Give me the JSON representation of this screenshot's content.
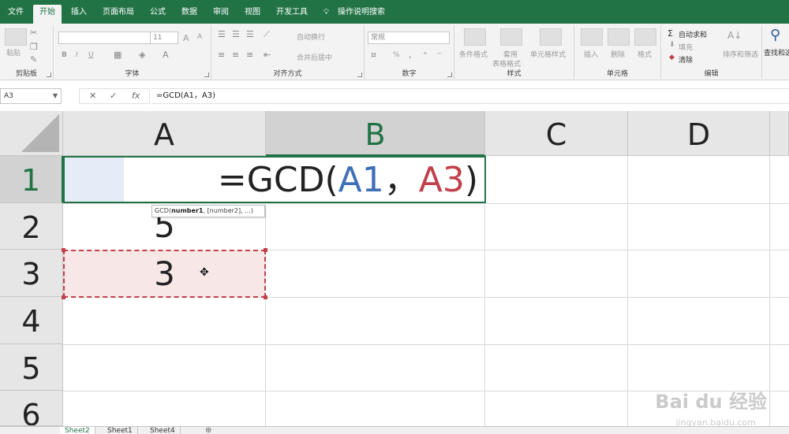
{
  "tabs": {
    "file": "文件",
    "home": "开始",
    "insert": "插入",
    "layout": "页面布局",
    "formulas": "公式",
    "data": "数据",
    "review": "审阅",
    "view": "视图",
    "developer": "开发工具",
    "help": "操作说明搜索"
  },
  "ribbon": {
    "clipboard": {
      "paste": "粘贴",
      "label": "剪贴板"
    },
    "font": {
      "size": "11",
      "bold": "B",
      "italic": "I",
      "underline": "U",
      "grow": "A",
      "shrink": "A",
      "label": "字体"
    },
    "alignment": {
      "wrap": "自动换行",
      "merge": "合并后居中",
      "label": "对齐方式"
    },
    "number": {
      "format": "常规",
      "percent": "%",
      "label": "数字"
    },
    "styles": {
      "conditional": "条件格式",
      "table1": "套用",
      "table2": "表格格式",
      "cell_styles": "单元格样式",
      "label": "样式"
    },
    "cells": {
      "insert": "插入",
      "delete": "删除",
      "format": "格式",
      "label": "单元格"
    },
    "editing": {
      "autosum": "自动求和",
      "fill": "填充",
      "clear": "清除",
      "sort": "排序和筛选",
      "find": "查找和选",
      "label": "编辑"
    }
  },
  "formula_bar": {
    "name_box": "A3",
    "cancel": "✕",
    "enter": "✓",
    "fx": "fx",
    "formula": "=GCD(A1，A3)"
  },
  "columns": [
    "A",
    "B",
    "C",
    "D"
  ],
  "rows": [
    "1",
    "2",
    "3",
    "4",
    "5",
    "6"
  ],
  "cells": {
    "B1_prefix": "=GCD(",
    "B1_ref1": "A1",
    "B1_sep": "，",
    "B1_ref2": "A3",
    "B1_suffix": ")",
    "A2": "5",
    "A3": "3"
  },
  "tooltip": {
    "fn": "GCD(",
    "arg1": "number1",
    "rest": ", [number2], ...)"
  },
  "sheets": [
    "Sheet2",
    "Sheet1",
    "Sheet4"
  ],
  "active_sheet": "Sheet2",
  "watermark": {
    "main": "Bai du 经验",
    "sub": "jingyan.baidu.com"
  },
  "colors": {
    "excel_green": "#217346",
    "ref_blue": "#3f6fb6",
    "ref_red": "#c0414b",
    "selection_fill": "#f7e7e7"
  },
  "icons": {
    "help": "lightbulb-icon",
    "cursor": "cell-cursor-icon",
    "add_sheet": "plus-icon",
    "find": "magnifier-icon",
    "autosum": "sigma-icon"
  }
}
